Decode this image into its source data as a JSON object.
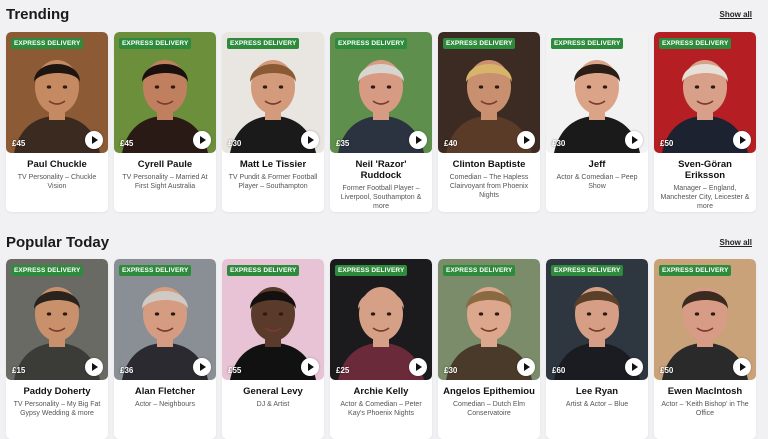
{
  "sections": [
    {
      "title": "Trending",
      "show_all": "Show all",
      "cards": [
        {
          "badge": "EXPRESS DELIVERY",
          "price": "£45",
          "name": "Paul Chuckle",
          "desc": "TV Personality – Chuckle Vision",
          "bg": "#8c5a34",
          "skin": "#c58a61",
          "hair": "#1e1410",
          "shirt": "#3a2a20"
        },
        {
          "badge": "EXPRESS DELIVERY",
          "price": "£45",
          "name": "Cyrell Paule",
          "desc": "TV Personality – Married At First Sight Australia",
          "bg": "#6b8f3a",
          "skin": "#c08060",
          "hair": "#1a1010",
          "shirt": "#2a1a16"
        },
        {
          "badge": "EXPRESS DELIVERY",
          "price": "£30",
          "name": "Matt Le Tissier",
          "desc": "TV Pundit & Former Football Player – Southampton",
          "bg": "#e9e6e2",
          "skin": "#d39a7c",
          "hair": "#8a5a34",
          "shirt": "#1a1a1a"
        },
        {
          "badge": "EXPRESS DELIVERY",
          "price": "£35",
          "name": "Neil 'Razor' Ruddock",
          "desc": "Former Football Player – Liverpool, Southampton & more",
          "bg": "#5f8f4c",
          "skin": "#d79b83",
          "hair": "#d8d4cf",
          "shirt": "#2b3240"
        },
        {
          "badge": "EXPRESS DELIVERY",
          "price": "£40",
          "name": "Clinton Baptiste",
          "desc": "Comedian – The Hapless Clairvoyant from Phoenix Nights",
          "bg": "#3b2b22",
          "skin": "#c99070",
          "hair": "#d8b46a",
          "shirt": "#5a3b28"
        },
        {
          "badge": "EXPRESS DELIVERY",
          "price": "£30",
          "name": "Jeff",
          "desc": "Actor & Comedian – Peep Show",
          "bg": "#f2f2f2",
          "skin": "#dba488",
          "hair": "#2a1c16",
          "shirt": "#1a1a1a"
        },
        {
          "badge": "EXPRESS DELIVERY",
          "price": "£50",
          "name": "Sven-Göran Eriksson",
          "desc": "Manager – England, Manchester City, Leicester & more",
          "bg": "#b51f24",
          "skin": "#d8a088",
          "hair": "#e6e0d8",
          "shirt": "#1d2230"
        }
      ]
    },
    {
      "title": "Popular Today",
      "show_all": "Show all",
      "cards": [
        {
          "badge": "EXPRESS DELIVERY",
          "price": "£15",
          "name": "Paddy Doherty",
          "desc": "TV Personality – My Big Fat Gypsy Wedding & more",
          "bg": "#6a6a64",
          "skin": "#c9906c",
          "hair": "#2a221c",
          "shirt": "#3b3b38"
        },
        {
          "badge": "EXPRESS DELIVERY",
          "price": "£36",
          "name": "Alan Fletcher",
          "desc": "Actor – Neighbours",
          "bg": "#8a8f96",
          "skin": "#d59c82",
          "hair": "#cfcac4",
          "shirt": "#2a2a30"
        },
        {
          "badge": "EXPRESS DELIVERY",
          "price": "£55",
          "name": "General Levy",
          "desc": "DJ & Artist",
          "bg": "#e8c3d6",
          "skin": "#5a3a2a",
          "hair": "#141010",
          "shirt": "#111111"
        },
        {
          "badge": "EXPRESS DELIVERY",
          "price": "£25",
          "name": "Archie Kelly",
          "desc": "Actor & Comedian – Peter Kay's Phoenix Nights",
          "bg": "#1b1b1e",
          "skin": "#d5a086",
          "hair": "#d5a086",
          "shirt": "#6b2a3a"
        },
        {
          "badge": "EXPRESS DELIVERY",
          "price": "£30",
          "name": "Angelos Epithemiou",
          "desc": "Comedian – Dutch Elm Conservatoire",
          "bg": "#7a8c6a",
          "skin": "#dca78c",
          "hair": "#8a6a40",
          "shirt": "#4a3a2a"
        },
        {
          "badge": "EXPRESS DELIVERY",
          "price": "£60",
          "name": "Lee Ryan",
          "desc": "Artist & Actor – Blue",
          "bg": "#2e3640",
          "skin": "#d69e84",
          "hair": "#5a4028",
          "shirt": "#1a1c22"
        },
        {
          "badge": "EXPRESS DELIVERY",
          "price": "£50",
          "name": "Ewen MacIntosh",
          "desc": "Actor – 'Keith Bishop' in The Office",
          "bg": "#caa27a",
          "skin": "#d89c86",
          "hair": "#3a2a20",
          "shirt": "#2a2a2a"
        }
      ]
    }
  ]
}
